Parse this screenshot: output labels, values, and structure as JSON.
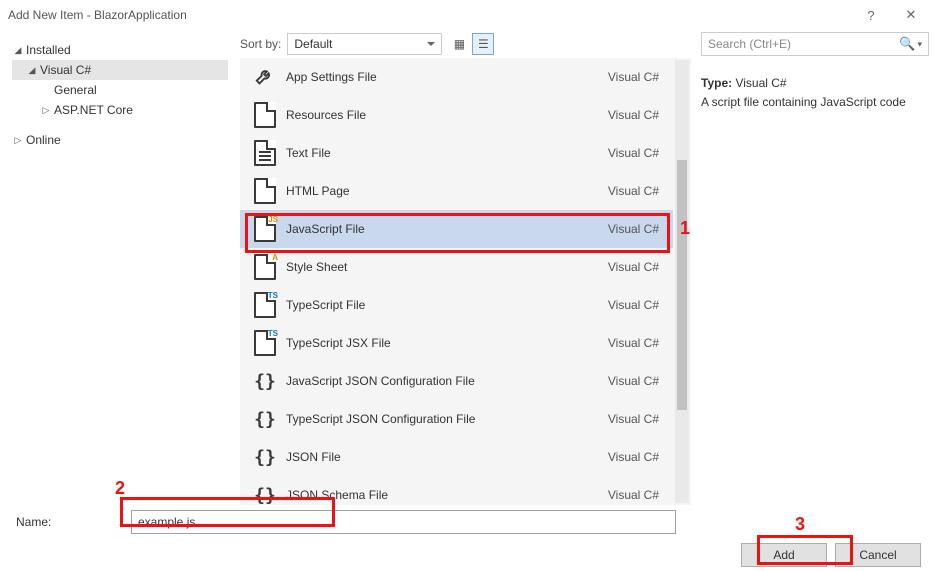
{
  "window": {
    "title": "Add New Item - BlazorApplication",
    "help_glyph": "?",
    "close_glyph": "✕"
  },
  "left_tree": {
    "installed": "Installed",
    "visual_cs": "Visual C#",
    "general": "General",
    "aspnet": "ASP.NET Core",
    "online": "Online"
  },
  "toolbar": {
    "sort_by_label": "Sort by:",
    "sort_value": "Default"
  },
  "templates": {
    "cat": "Visual C#",
    "items": [
      {
        "label": "App Settings File",
        "icon": "wrench"
      },
      {
        "label": "Resources File",
        "icon": "page"
      },
      {
        "label": "Text File",
        "icon": "page-lines"
      },
      {
        "label": "HTML Page",
        "icon": "page"
      },
      {
        "label": "JavaScript File",
        "icon": "page",
        "badge": "JS",
        "badgeCls": "js",
        "selected": true
      },
      {
        "label": "Style Sheet",
        "icon": "page",
        "badge": "A",
        "badgeCls": "js"
      },
      {
        "label": "TypeScript File",
        "icon": "page",
        "badge": "TS",
        "badgeCls": "ts"
      },
      {
        "label": "TypeScript JSX File",
        "icon": "page",
        "badge": "TS",
        "badgeCls": "ts"
      },
      {
        "label": "JavaScript JSON Configuration File",
        "icon": "curly"
      },
      {
        "label": "TypeScript JSON Configuration File",
        "icon": "curly"
      },
      {
        "label": "JSON File",
        "icon": "curly"
      },
      {
        "label": "JSON Schema File",
        "icon": "curly"
      }
    ]
  },
  "search": {
    "placeholder": "Search (Ctrl+E)"
  },
  "info_panel": {
    "type_label": "Type:",
    "type_value": "Visual C#",
    "description": "A script file containing JavaScript code"
  },
  "footer": {
    "name_label": "Name:",
    "name_value": "example.js",
    "add_label": "Add",
    "cancel_label": "Cancel"
  },
  "annotations": {
    "a1": "1",
    "a2": "2",
    "a3": "3"
  }
}
